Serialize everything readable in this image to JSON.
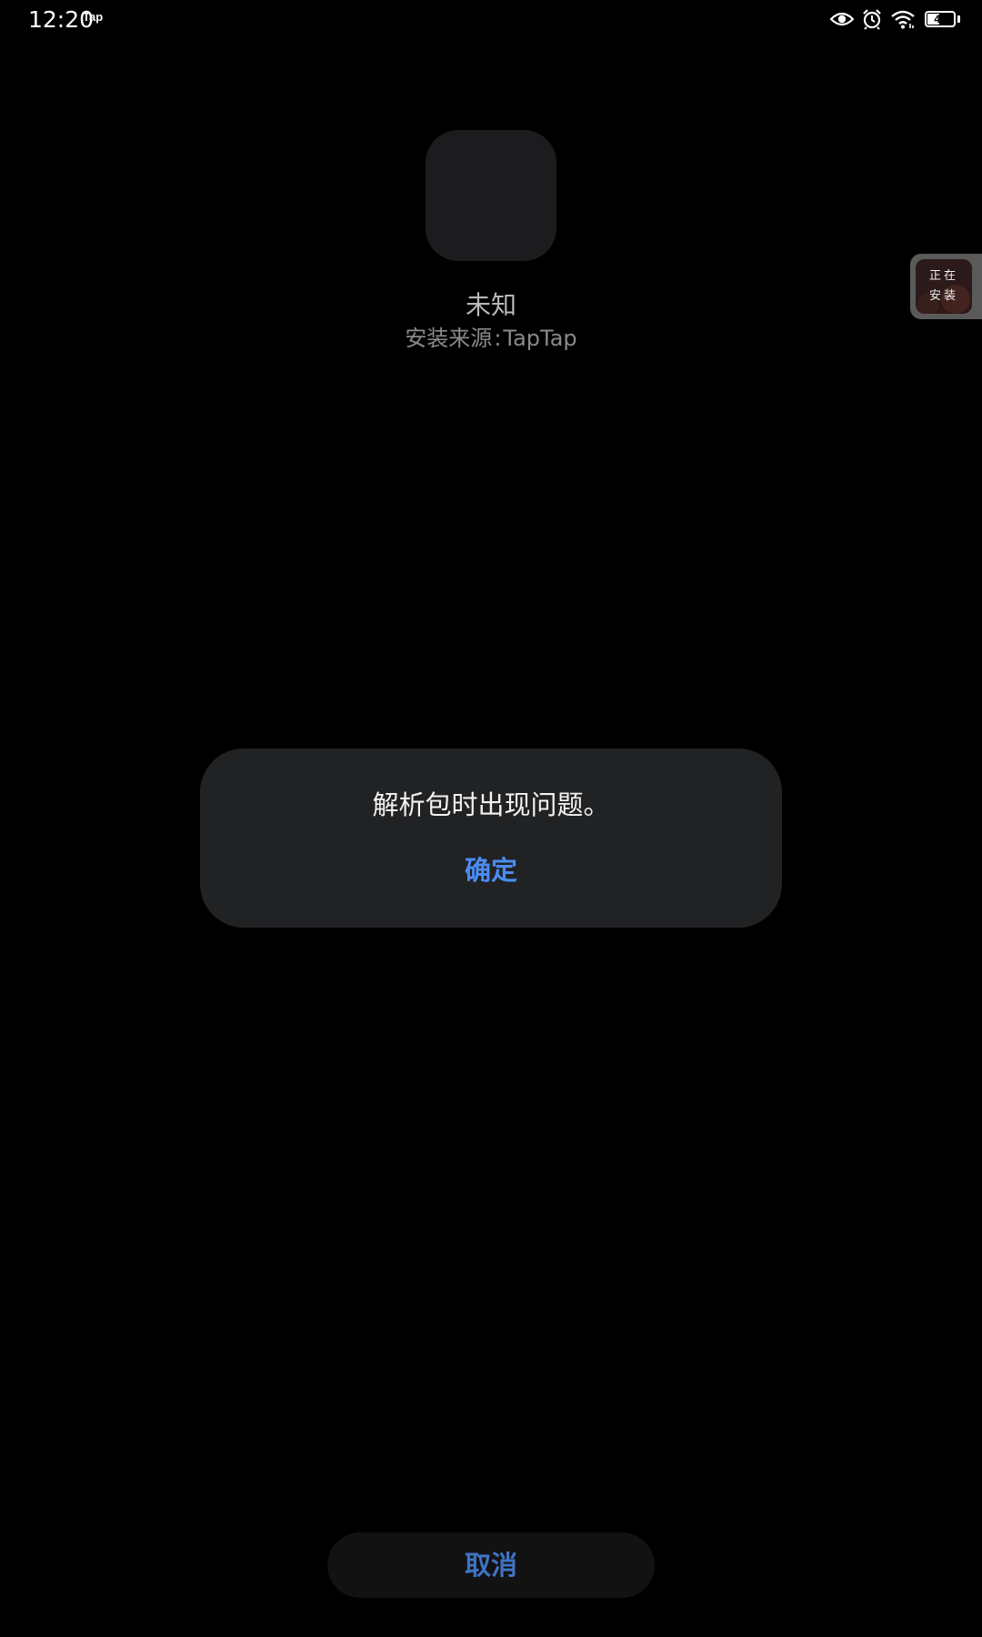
{
  "status_bar": {
    "time": "12:20",
    "notification_app": "Tap",
    "battery_level": "45",
    "battery_fraction": 0.45,
    "icons": [
      "eye-icon",
      "alarm-icon",
      "wifi-icon",
      "battery-icon"
    ]
  },
  "app": {
    "name": "未知",
    "install_source_label": "安装来源",
    "install_source_sep": ":",
    "install_source_value": "TapTap"
  },
  "floating_bubble": {
    "line1": "正在",
    "line2": "安装"
  },
  "dialog": {
    "message": "解析包时出现问题。",
    "confirm_label": "确定"
  },
  "footer": {
    "cancel_label": "取消"
  },
  "colors": {
    "background": "#000000",
    "dialog_background": "#212224",
    "accent_blue": "#4a8cf2",
    "cancel_blue": "#3f73c4"
  }
}
